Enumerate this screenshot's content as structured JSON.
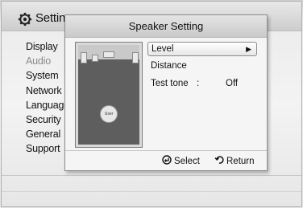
{
  "background_menu": {
    "title": "Settings",
    "items": [
      "Display",
      "Audio",
      "System",
      "Network",
      "Language",
      "Security",
      "General",
      "Support"
    ],
    "dim_index": 1
  },
  "dialog": {
    "title": "Speaker Setting",
    "user_label": "User",
    "options": [
      {
        "label": "Level",
        "selected": true
      },
      {
        "label": "Distance",
        "selected": false
      },
      {
        "label": "Test tone",
        "value": "Off",
        "separator": ":"
      }
    ],
    "footer": {
      "select_label": "Select",
      "return_label": "Return"
    }
  },
  "icons": {
    "title": "gear-icon",
    "select": "enter-icon",
    "return": "return-icon",
    "arrow": "arrow-right-icon"
  }
}
